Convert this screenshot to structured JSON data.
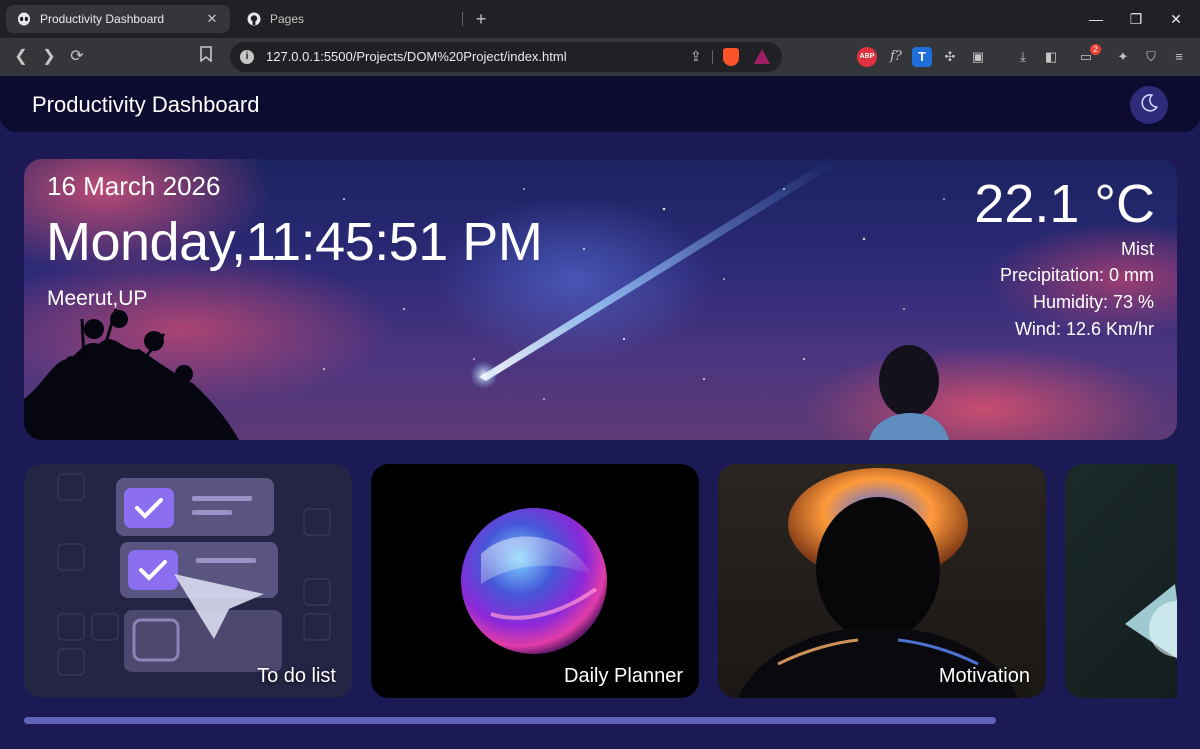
{
  "browser": {
    "tabs": [
      {
        "title": "Productivity Dashboard",
        "active": true,
        "icon": "alien-icon"
      },
      {
        "title": "Pages",
        "active": false,
        "icon": "github-icon"
      }
    ],
    "url": "127.0.0.1:5500/Projects/DOM%20Project/index.html",
    "extensions_badge": "2"
  },
  "app": {
    "title": "Productivity Dashboard",
    "theme_icon": "moon-icon"
  },
  "hero": {
    "date": "16 March 2026",
    "day_time": "Monday,11:45:51 PM",
    "location": "Meerut,UP",
    "temperature": "22.1 °C",
    "condition": "Mist",
    "precipitation": "Precipitation: 0 mm",
    "humidity": "Humidity: 73 %",
    "wind": "Wind: 12.6 Km/hr"
  },
  "cards": [
    {
      "label": "To do list"
    },
    {
      "label": "Daily Planner"
    },
    {
      "label": "Motivation"
    },
    {
      "label": ""
    }
  ],
  "colors": {
    "page_bg": "#1c1a55",
    "header_bg": "#0d0c30",
    "accent": "#2d2b7a"
  }
}
